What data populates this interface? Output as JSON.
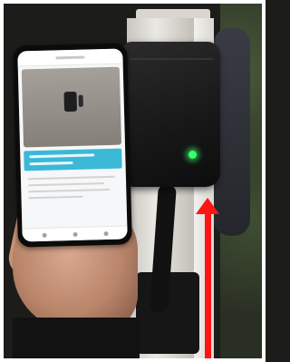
{
  "scene": {
    "description_objects": [
      "phone",
      "charging-unit",
      "led-indicator",
      "arrow"
    ],
    "colors": {
      "led": "#39ff6a",
      "arrow": "#ff1414",
      "app_banner": "#3cb8d7"
    }
  }
}
